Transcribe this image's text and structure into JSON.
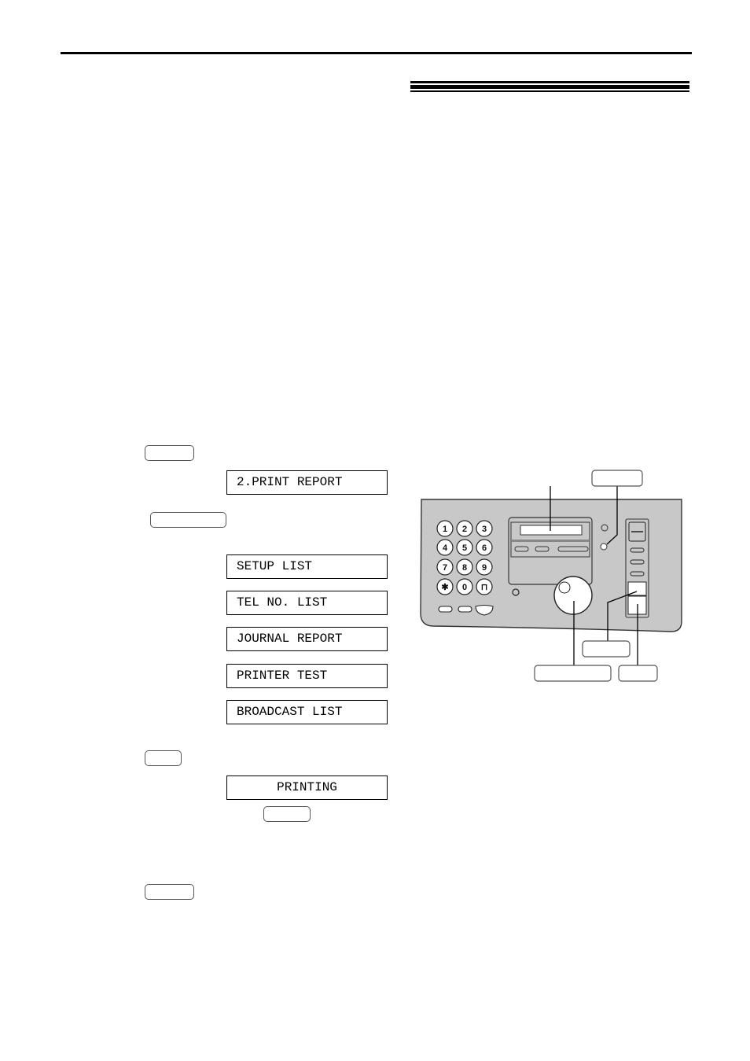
{
  "page": {
    "header_rule": "top-rule",
    "section_title_rule": "triple-rule"
  },
  "steps": {
    "step1_button": "",
    "display_menu": "2.PRINT REPORT",
    "step2_button": "",
    "report_options": [
      "SETUP LIST",
      "TEL NO. LIST",
      "JOURNAL REPORT",
      "PRINTER TEST",
      "BROADCAST LIST"
    ],
    "step3_button": "",
    "display_printing": "PRINTING",
    "stop_button_inline": "",
    "step4_button": ""
  },
  "diagram": {
    "keypad": [
      "1",
      "2",
      "3",
      "4",
      "5",
      "6",
      "7",
      "8",
      "9",
      "✱",
      "0",
      "⊓"
    ],
    "callout_labels": {
      "top_right": "",
      "middle": "",
      "bottom_left": "",
      "bottom_right": ""
    },
    "colors": {
      "panel": "#c8c8c8",
      "panel_outline": "#333333",
      "key_fill": "#ffffff"
    }
  }
}
